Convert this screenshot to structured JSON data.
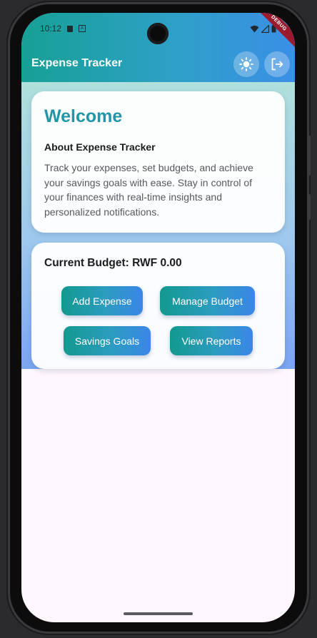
{
  "status_bar": {
    "time": "10:12",
    "badge": "A"
  },
  "debug_banner": "DEBUG",
  "app_bar": {
    "title": "Expense Tracker",
    "icons": [
      "sun-icon",
      "logout-icon"
    ]
  },
  "welcome_card": {
    "heading": "Welcome",
    "subheading": "About Expense Tracker",
    "description": "Track your expenses, set budgets, and achieve your savings goals with ease. Stay in control of your finances with real-time insights and personalized notifications."
  },
  "budget_card": {
    "label": "Current Budget: RWF 0.00",
    "buttons": {
      "add_expense": "Add Expense",
      "manage_budget": "Manage Budget",
      "savings_goals": "Savings Goals",
      "view_reports": "View Reports"
    }
  },
  "colors": {
    "header_start": "#16a095",
    "header_end": "#3b8fe6",
    "heading": "#2196a6",
    "background": "#fff7fd"
  }
}
